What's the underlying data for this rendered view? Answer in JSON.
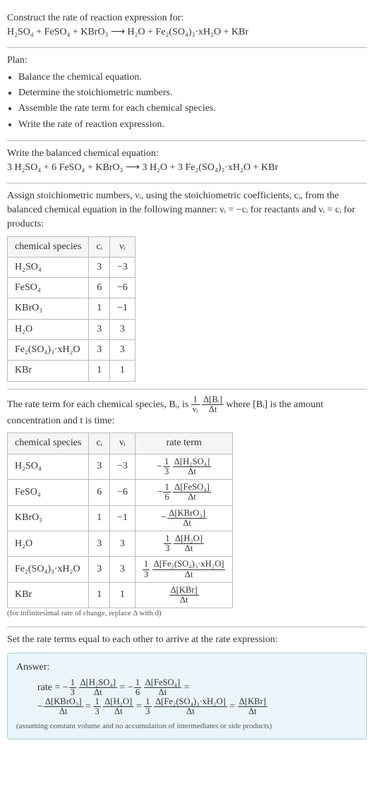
{
  "intro": {
    "title": "Construct the rate of reaction expression for:",
    "equation": "H₂SO₄ + FeSO₄ + KBrO₃  ⟶  H₂O + Fe₂(SO₄)₃·xH₂O + KBr"
  },
  "plan": {
    "heading": "Plan:",
    "items": [
      "Balance the chemical equation.",
      "Determine the stoichiometric numbers.",
      "Assemble the rate term for each chemical species.",
      "Write the rate of reaction expression."
    ]
  },
  "balanced": {
    "heading": "Write the balanced chemical equation:",
    "equation": "3 H₂SO₄ + 6 FeSO₄ + KBrO₃  ⟶  3 H₂O + 3 Fe₂(SO₄)₃·xH₂O + KBr"
  },
  "stoich": {
    "text1": "Assign stoichiometric numbers, νᵢ, using the stoichiometric coefficients, cᵢ, from the balanced chemical equation in the following manner: νᵢ = −cᵢ for reactants and νᵢ = cᵢ for products:",
    "headers": {
      "species": "chemical species",
      "c": "cᵢ",
      "v": "νᵢ"
    },
    "rows": [
      {
        "species": "H₂SO₄",
        "c": "3",
        "v": "−3"
      },
      {
        "species": "FeSO₄",
        "c": "6",
        "v": "−6"
      },
      {
        "species": "KBrO₃",
        "c": "1",
        "v": "−1"
      },
      {
        "species": "H₂O",
        "c": "3",
        "v": "3"
      },
      {
        "species": "Fe₂(SO₄)₃·xH₂O",
        "c": "3",
        "v": "3"
      },
      {
        "species": "KBr",
        "c": "1",
        "v": "1"
      }
    ]
  },
  "rateterm": {
    "text_a": "The rate term for each chemical species, Bᵢ, is ",
    "text_b": " where [Bᵢ] is the amount concentration and t is time:",
    "headers": {
      "species": "chemical species",
      "c": "cᵢ",
      "v": "νᵢ",
      "rate": "rate term"
    },
    "rows": [
      {
        "species": "H₂SO₄",
        "c": "3",
        "v": "−3",
        "sign": "−",
        "coef_num": "1",
        "coef_den": "3",
        "dnum": "Δ[H₂SO₄]",
        "dden": "Δt"
      },
      {
        "species": "FeSO₄",
        "c": "6",
        "v": "−6",
        "sign": "−",
        "coef_num": "1",
        "coef_den": "6",
        "dnum": "Δ[FeSO₄]",
        "dden": "Δt"
      },
      {
        "species": "KBrO₃",
        "c": "1",
        "v": "−1",
        "sign": "−",
        "coef_num": "",
        "coef_den": "",
        "dnum": "Δ[KBrO₃]",
        "dden": "Δt"
      },
      {
        "species": "H₂O",
        "c": "3",
        "v": "3",
        "sign": "",
        "coef_num": "1",
        "coef_den": "3",
        "dnum": "Δ[H₂O]",
        "dden": "Δt"
      },
      {
        "species": "Fe₂(SO₄)₃·xH₂O",
        "c": "3",
        "v": "3",
        "sign": "",
        "coef_num": "1",
        "coef_den": "3",
        "dnum": "Δ[Fe₂(SO₄)₃·xH₂O]",
        "dden": "Δt"
      },
      {
        "species": "KBr",
        "c": "1",
        "v": "1",
        "sign": "",
        "coef_num": "",
        "coef_den": "",
        "dnum": "Δ[KBr]",
        "dden": "Δt"
      }
    ],
    "note": "(for infinitesimal rate of change, replace Δ with d)"
  },
  "final": {
    "heading": "Set the rate terms equal to each other to arrive at the rate expression:"
  },
  "answer": {
    "label": "Answer:",
    "prefix": "rate = ",
    "terms": [
      {
        "sign": "−",
        "coef_num": "1",
        "coef_den": "3",
        "dnum": "Δ[H₂SO₄]",
        "dden": "Δt",
        "after": " = "
      },
      {
        "sign": "−",
        "coef_num": "1",
        "coef_den": "6",
        "dnum": "Δ[FeSO₄]",
        "dden": "Δt",
        "after": " ="
      },
      {
        "sign": "−",
        "coef_num": "",
        "coef_den": "",
        "dnum": "Δ[KBrO₃]",
        "dden": "Δt",
        "after": " = "
      },
      {
        "sign": "",
        "coef_num": "1",
        "coef_den": "3",
        "dnum": "Δ[H₂O]",
        "dden": "Δt",
        "after": " = "
      },
      {
        "sign": "",
        "coef_num": "1",
        "coef_den": "3",
        "dnum": "Δ[Fe₂(SO₄)₃·xH₂O]",
        "dden": "Δt",
        "after": " = "
      },
      {
        "sign": "",
        "coef_num": "",
        "coef_den": "",
        "dnum": "Δ[KBr]",
        "dden": "Δt",
        "after": ""
      }
    ],
    "note": "(assuming constant volume and no accumulation of intermediates or side products)"
  },
  "chart_data": {
    "type": "table",
    "tables": [
      {
        "title": "Stoichiometric numbers",
        "columns": [
          "chemical species",
          "cᵢ",
          "νᵢ"
        ],
        "rows": [
          [
            "H₂SO₄",
            3,
            -3
          ],
          [
            "FeSO₄",
            6,
            -6
          ],
          [
            "KBrO₃",
            1,
            -1
          ],
          [
            "H₂O",
            3,
            3
          ],
          [
            "Fe₂(SO₄)₃·xH₂O",
            3,
            3
          ],
          [
            "KBr",
            1,
            1
          ]
        ]
      },
      {
        "title": "Rate terms",
        "columns": [
          "chemical species",
          "cᵢ",
          "νᵢ",
          "rate term"
        ],
        "rows": [
          [
            "H₂SO₄",
            3,
            -3,
            "-(1/3) Δ[H₂SO₄]/Δt"
          ],
          [
            "FeSO₄",
            6,
            -6,
            "-(1/6) Δ[FeSO₄]/Δt"
          ],
          [
            "KBrO₃",
            1,
            -1,
            "-Δ[KBrO₃]/Δt"
          ],
          [
            "H₂O",
            3,
            3,
            "(1/3) Δ[H₂O]/Δt"
          ],
          [
            "Fe₂(SO₄)₃·xH₂O",
            3,
            3,
            "(1/3) Δ[Fe₂(SO₄)₃·xH₂O]/Δt"
          ],
          [
            "KBr",
            1,
            1,
            "Δ[KBr]/Δt"
          ]
        ]
      }
    ]
  }
}
